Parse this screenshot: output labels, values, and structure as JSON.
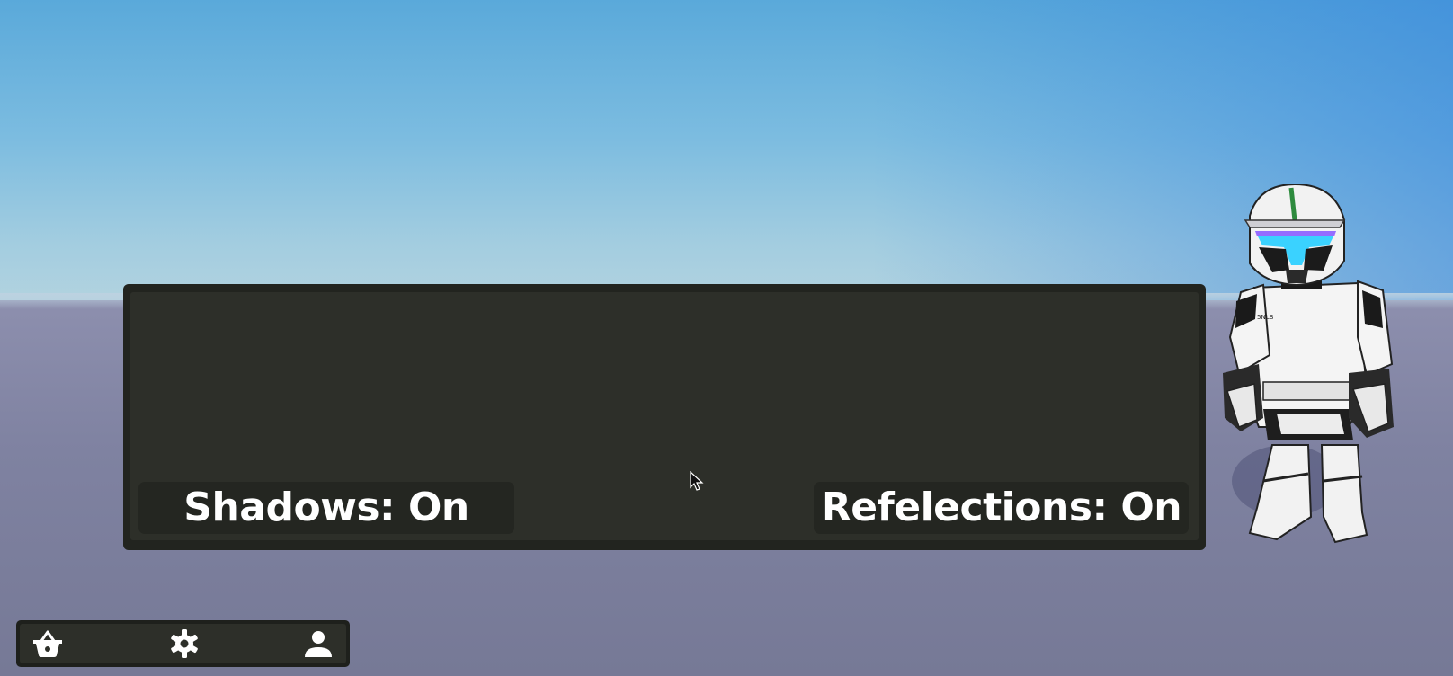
{
  "scene": {
    "sky_color_top": "#5aa9da",
    "sky_color_bottom": "#b3d3df",
    "ground_color": "#7f82a1"
  },
  "settings_panel": {
    "shadows_button": {
      "label": "Shadows: On"
    },
    "reflections_button": {
      "label": "Refelections: On"
    },
    "panel_color": "#2d2f29",
    "button_color": "#242621"
  },
  "toolbar": {
    "items": [
      {
        "icon": "shop-basket-icon"
      },
      {
        "icon": "gear-icon"
      },
      {
        "icon": "profile-person-icon"
      }
    ]
  },
  "character": {
    "description_icon": "clone-trooper-avatar"
  }
}
